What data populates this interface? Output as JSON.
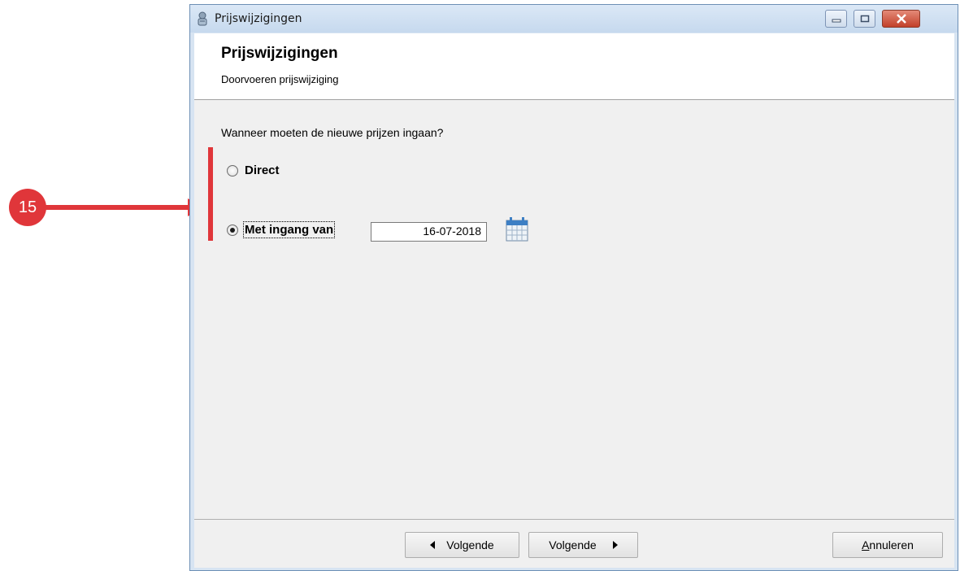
{
  "window": {
    "title": "Prijswijzigingen",
    "controls": {
      "minimize": "minimize-icon",
      "maximize": "maximize-icon",
      "close": "close-icon"
    }
  },
  "header": {
    "title": "Prijswijzigingen",
    "subtitle": "Doorvoeren prijswijziging"
  },
  "content": {
    "question": "Wanneer moeten de nieuwe prijzen ingaan?",
    "options": [
      {
        "label": "Direct",
        "selected": false
      },
      {
        "label": "Met ingang van",
        "selected": true
      }
    ],
    "date_value": "16-07-2018",
    "calendar_icon": "calendar-icon"
  },
  "footer": {
    "prev_label": "Volgende",
    "next_label": "Volgende",
    "cancel_label": "Annuleren"
  },
  "annotation": {
    "badge_number": "15",
    "color": "#e0363a"
  }
}
